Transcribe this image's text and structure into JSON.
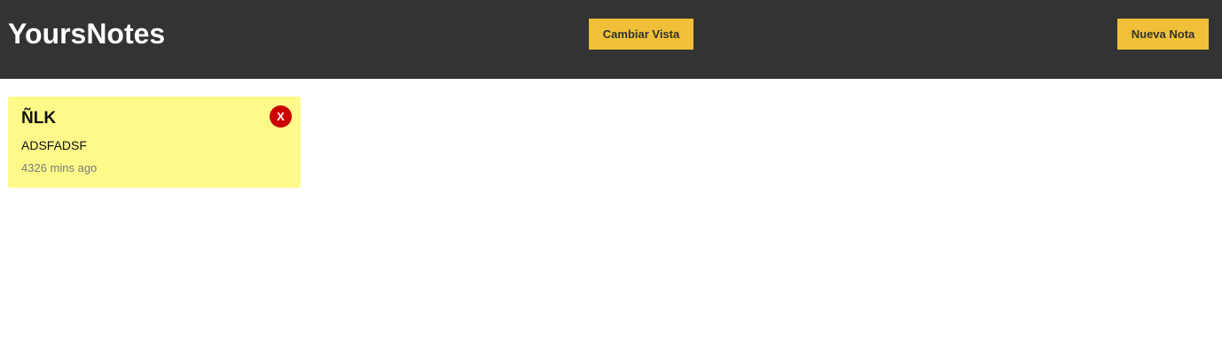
{
  "header": {
    "app_title": "YoursNotes",
    "change_view_label": "Cambiar Vista",
    "new_note_label": "Nueva Nota"
  },
  "notes": [
    {
      "title": "ÑLK",
      "body": "ADSFADSF",
      "time_ago": "4326 mins ago",
      "delete_label": "X"
    }
  ],
  "colors": {
    "header_bg": "#333333",
    "accent_button": "#f0c038",
    "note_bg": "#fff98a",
    "delete_bg": "#cc0000"
  }
}
